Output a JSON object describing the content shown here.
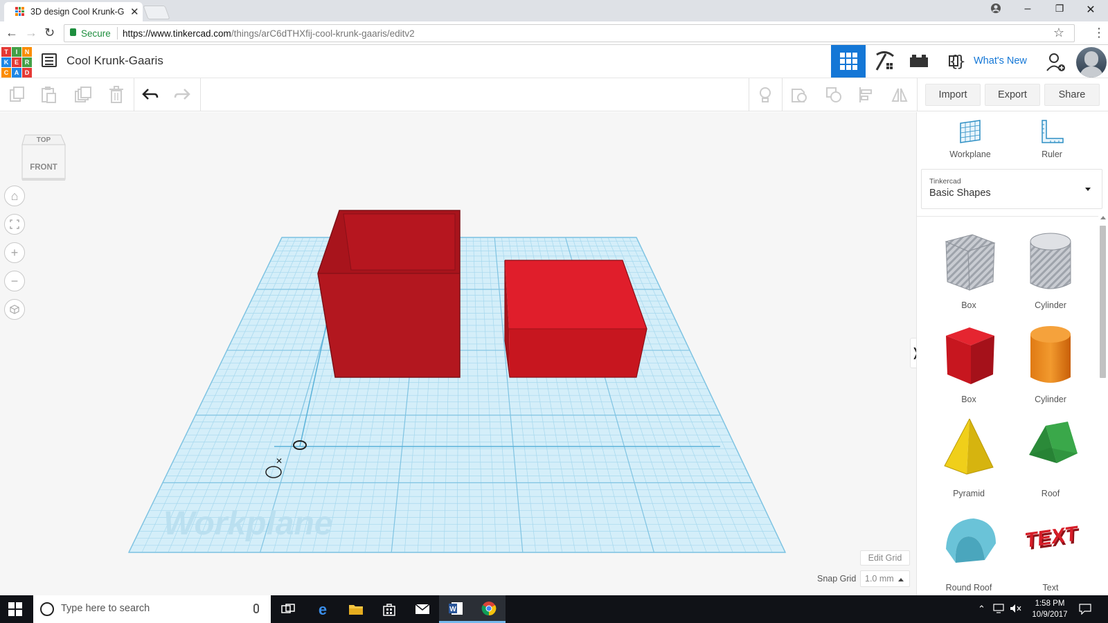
{
  "browser": {
    "tab_title": "3D design Cool Krunk-Gaaris",
    "secure_label": "Secure",
    "url_prefix": "https://www.tinkercad.com",
    "url_path": "/things/arC6dTHXfij-cool-krunk-gaaris/editv2"
  },
  "app": {
    "logo_letters": [
      "T",
      "I",
      "N",
      "K",
      "E",
      "R",
      "C",
      "A",
      "D"
    ],
    "design_title": "Cool Krunk-Gaaris",
    "whats_new": "What's New",
    "accent": "#1477d6"
  },
  "toolbar": {
    "import": "Import",
    "export": "Export",
    "share": "Share"
  },
  "viewcube": {
    "top": "TOP",
    "front": "FRONT"
  },
  "workplane": {
    "watermark": "Workplane",
    "edit_grid": "Edit Grid",
    "snap_grid_label": "Snap Grid",
    "snap_grid_value": "1.0 mm"
  },
  "panel": {
    "workplane_tool": "Workplane",
    "ruler_tool": "Ruler",
    "library_vendor": "Tinkercad",
    "library_name": "Basic Shapes",
    "shapes": [
      {
        "label": "Box",
        "icon": "box-hole-icon"
      },
      {
        "label": "Cylinder",
        "icon": "cylinder-hole-icon"
      },
      {
        "label": "Box",
        "icon": "box-icon"
      },
      {
        "label": "Cylinder",
        "icon": "cylinder-icon"
      },
      {
        "label": "Pyramid",
        "icon": "pyramid-icon"
      },
      {
        "label": "Roof",
        "icon": "roof-icon"
      },
      {
        "label": "Round Roof",
        "icon": "round-roof-icon"
      },
      {
        "label": "Text",
        "icon": "text-icon"
      }
    ]
  },
  "taskbar": {
    "search_placeholder": "Type here to search",
    "time": "1:58 PM",
    "date": "10/9/2017"
  }
}
